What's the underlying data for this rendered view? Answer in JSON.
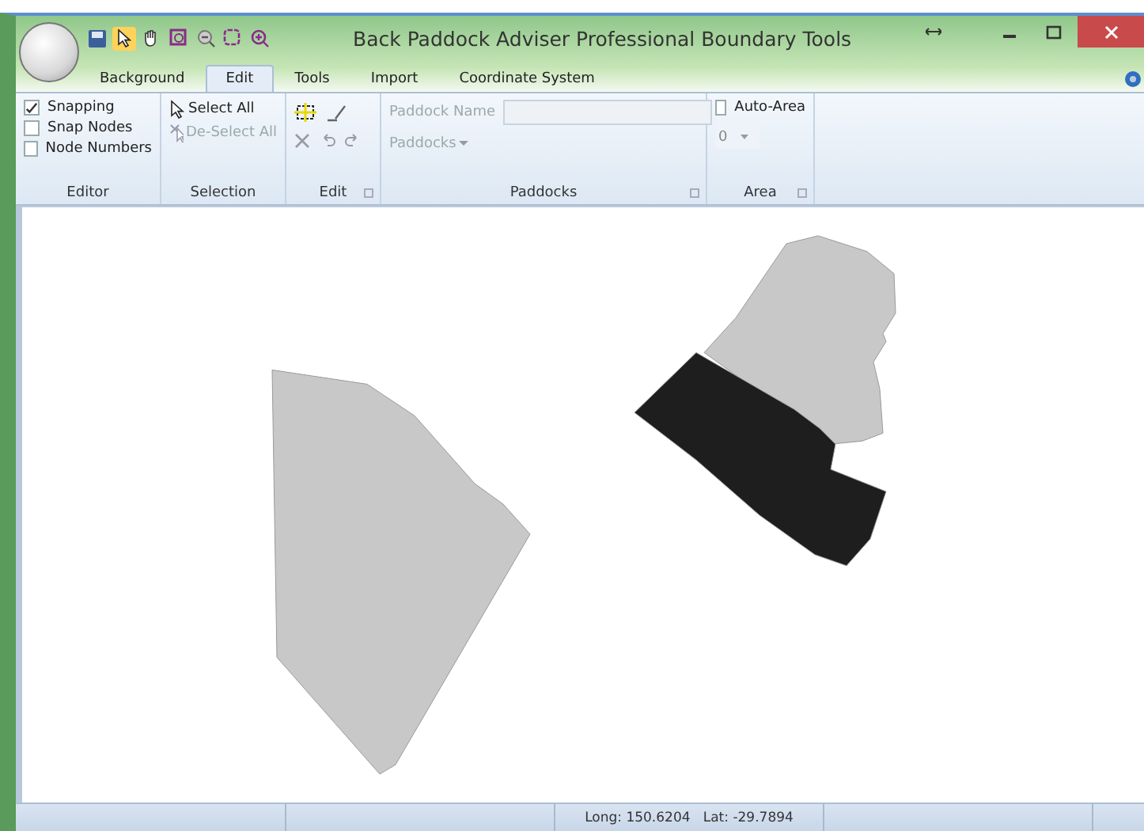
{
  "window": {
    "title": "Back Paddock Adviser Professional Boundary Tools"
  },
  "tabs": [
    {
      "label": "Background",
      "selected": false
    },
    {
      "label": "Edit",
      "selected": true
    },
    {
      "label": "Tools",
      "selected": false
    },
    {
      "label": "Import",
      "selected": false
    },
    {
      "label": "Coordinate System",
      "selected": false
    }
  ],
  "ribbon": {
    "editor": {
      "label": "Editor",
      "options": [
        {
          "label": "Snapping",
          "checked": true
        },
        {
          "label": "Snap Nodes",
          "checked": false
        },
        {
          "label": "Node Numbers",
          "checked": false
        }
      ]
    },
    "selection": {
      "label": "Selection",
      "buttons": [
        {
          "label": "Select All",
          "disabled": false
        },
        {
          "label": "De-Select All",
          "disabled": true
        }
      ]
    },
    "edit": {
      "label": "Edit"
    },
    "paddocks": {
      "label": "Paddocks",
      "name_label": "Paddock Name",
      "dropdown": "Paddocks"
    },
    "area": {
      "label": "Area",
      "auto_area": {
        "label": "Auto-Area",
        "checked": false
      },
      "value": "0"
    }
  },
  "status_bar": {
    "coordinates": "Long: 150.6204   Lat: -29.7894"
  }
}
